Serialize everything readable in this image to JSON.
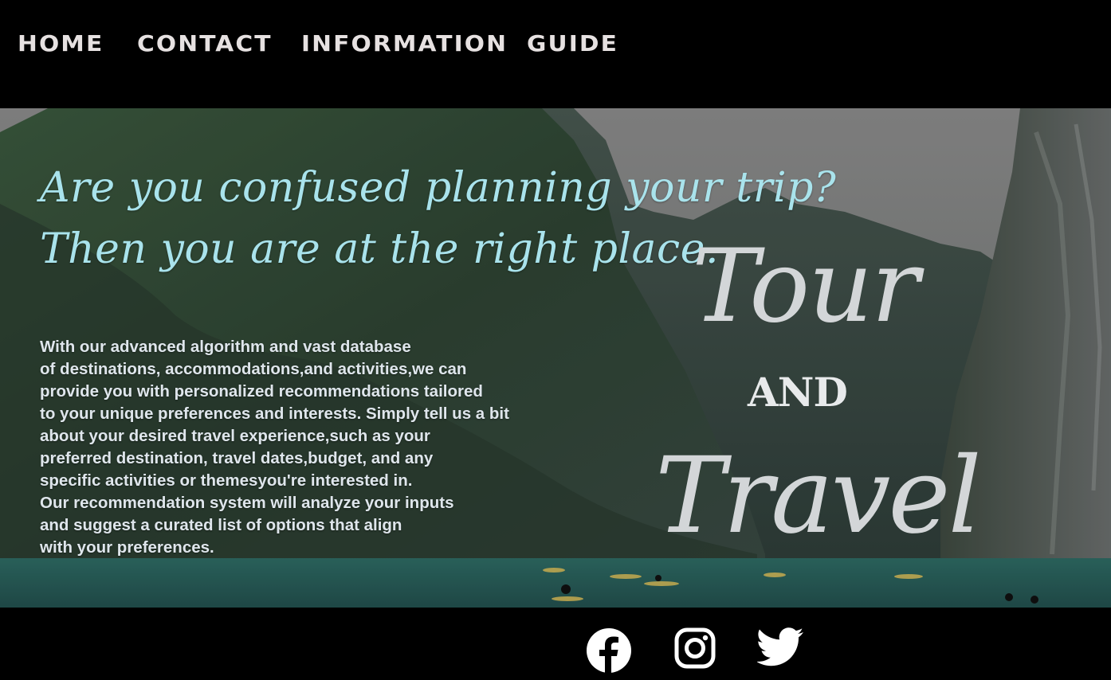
{
  "nav": {
    "items": [
      "HOME",
      "CONTACT",
      "INFORMATION",
      "GUIDE"
    ]
  },
  "hero": {
    "tagline_line1": "Are you confused planning your trip?",
    "tagline_line2": "Then you are at the right place.",
    "description_lines": [
      "With our advanced algorithm and vast database",
      "of destinations, accommodations,and activities,we can",
      "provide you with personalized recommendations tailored",
      "to your unique preferences and interests. Simply tell us a bit",
      "about your desired travel experience,such as your",
      "preferred destination, travel dates,budget, and any",
      "specific activities or themesyou're interested in.",
      "Our recommendation system will analyze your inputs",
      "and suggest a curated list of options that align",
      "with your preferences."
    ],
    "brand_word1": "Tour",
    "brand_and": "AND",
    "brand_word2": "Travel"
  },
  "footer": {
    "social_icons": [
      "facebook-icon",
      "instagram-icon",
      "twitter-icon"
    ]
  },
  "colors": {
    "background": "#000000",
    "nav_text": "#e6e1e1",
    "tagline": "#a9e3ec",
    "description": "#dfe6ec",
    "brand": "#d3d6d8",
    "icons": "#ffffff"
  }
}
